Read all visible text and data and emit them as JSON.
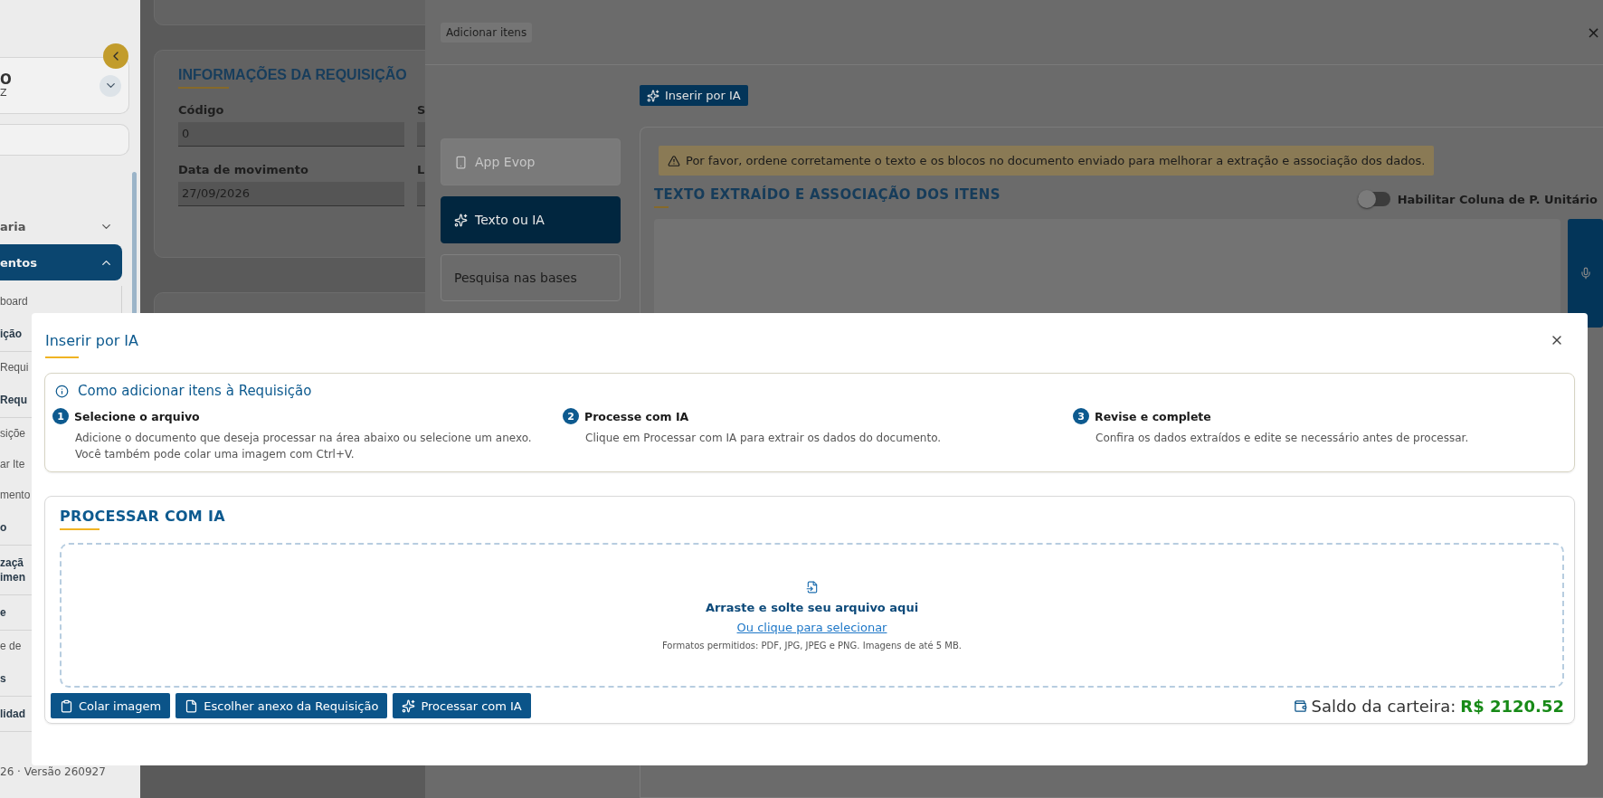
{
  "sidebar": {
    "user": {
      "name": "O",
      "subtitle": "Z"
    },
    "items": [
      {
        "label": "aria",
        "kind": "group",
        "expanded": false
      },
      {
        "label": "entos",
        "kind": "group",
        "expanded": true,
        "children": [
          {
            "label": "board",
            "kind": "link"
          },
          {
            "label": "ição",
            "kind": "section"
          },
          {
            "label": "Requi",
            "kind": "link"
          },
          {
            "label": "Requ",
            "kind": "section"
          },
          {
            "label": "siçõe",
            "kind": "link"
          },
          {
            "label": "ar Ite",
            "kind": "link"
          },
          {
            "label": "mento",
            "kind": "link"
          }
        ]
      },
      {
        "label": "o",
        "kind": "section"
      },
      {
        "label": "zaçã\nimen",
        "kind": "section"
      },
      {
        "label": "e",
        "kind": "section"
      },
      {
        "label": "e de",
        "kind": "link"
      },
      {
        "label": "s",
        "kind": "section"
      },
      {
        "label": "lidad",
        "kind": "section"
      }
    ],
    "footer": "26 · Versão 260927"
  },
  "form": {
    "title": "INFORMAÇÕES DA REQUISIÇÃO",
    "fields": [
      {
        "label": "Código",
        "value": "0"
      },
      {
        "label": "S"
      },
      {
        "label": "Data de movimento",
        "value": "27/09/2026"
      },
      {
        "label": "L"
      }
    ]
  },
  "drawer": {
    "title": "Adicionar itens",
    "close": "×",
    "tabs": [
      {
        "label": "App Evop",
        "selected": false,
        "disabled": true
      },
      {
        "label": "Texto ou IA",
        "selected": true,
        "disabled": false
      },
      {
        "label": "Pesquisa nas bases",
        "selected": false,
        "disabled": false
      }
    ],
    "ai_button": "Inserir por IA",
    "warning": "Por favor, ordene corretamente o texto e os blocos no documento enviado para melhorar a extração e associação dos dados.",
    "heading": "TEXTO EXTRAÍDO E ASSOCIAÇÃO DOS ITENS",
    "toggle": {
      "label": "Habilitar Coluna de P. Unitário",
      "on": false
    }
  },
  "modal": {
    "title": "Inserir por IA",
    "info": {
      "title": "Como adicionar itens à Requisição",
      "steps": [
        {
          "number": "1",
          "title": "Selecione o arquivo",
          "text": "Adicione o documento que deseja processar na área abaixo ou selecione um anexo. Você também pode colar uma imagem com Ctrl+V."
        },
        {
          "number": "2",
          "title": "Processe com IA",
          "text": "Clique em Processar com IA para extrair os dados do documento."
        },
        {
          "number": "3",
          "title": "Revise e complete",
          "text": "Confira os dados extraídos e edite se necessário antes de processar."
        }
      ]
    },
    "process": {
      "title": "PROCESSAR COM IA",
      "dropzone": {
        "title": "Arraste e solte seu arquivo aqui",
        "link": "Ou clique para selecionar",
        "hint": "Formatos permitidos: PDF, JPG, JPEG e PNG. Imagens de até 5 MB."
      },
      "buttons": [
        "Colar imagem",
        "Escolher anexo da Requisição",
        "Processar com IA"
      ],
      "wallet": {
        "label": "Saldo da carteira:",
        "amount": "R$ 2120.52"
      }
    }
  }
}
